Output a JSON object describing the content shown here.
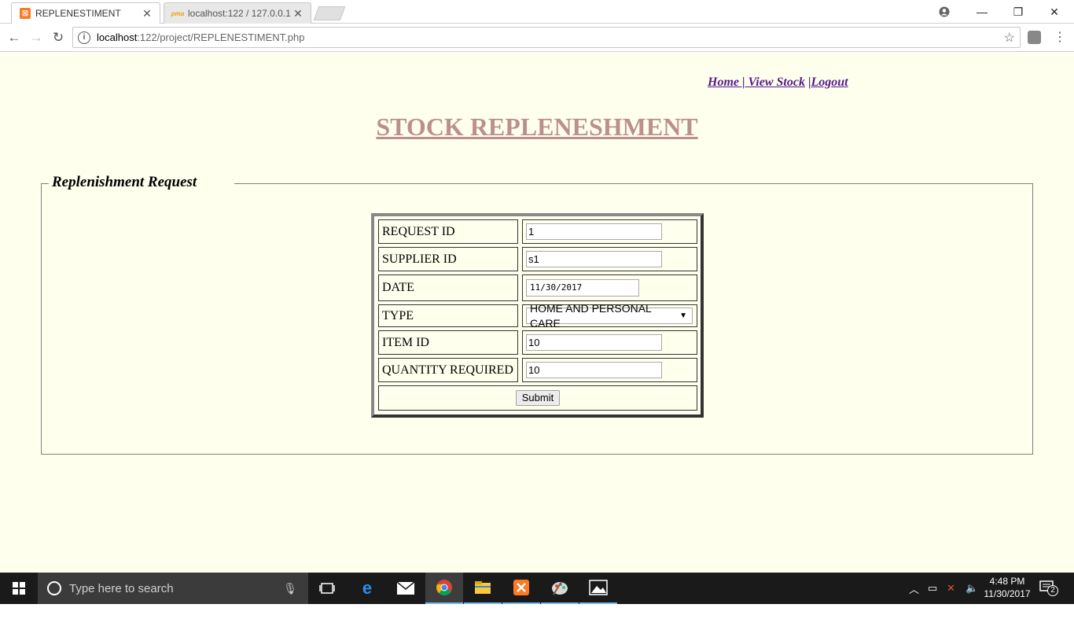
{
  "browser": {
    "tabs": [
      {
        "title": "REPLENESTIMENT",
        "favicon": "xampp-icon",
        "active": true
      },
      {
        "title": "localhost:122 / 127.0.0.1",
        "favicon": "phpmyadmin-icon",
        "active": false
      }
    ],
    "url_host": "localhost",
    "url_path": ":122/project/REPLENESTIMENT.php"
  },
  "nav": {
    "home": "Home |",
    "view_stock": " View Stock",
    "separator": " |",
    "logout": "Logout"
  },
  "page_title": "STOCK REPLENESHMENT",
  "fieldset_legend": "Replenishment Request",
  "form": {
    "rows": [
      {
        "label": "REQUEST ID",
        "value": "1"
      },
      {
        "label": "SUPPLIER ID",
        "value": "s1"
      },
      {
        "label": "DATE",
        "value": "11/30/2017"
      },
      {
        "label": "TYPE",
        "value": "HOME AND PERSONAL CARE"
      },
      {
        "label": "ITEM ID",
        "value": "10"
      },
      {
        "label": "QUANTITY REQUIRED",
        "value": "10"
      }
    ],
    "submit_label": "Submit"
  },
  "taskbar": {
    "search_placeholder": "Type here to search",
    "time": "4:48 PM",
    "date": "11/30/2017",
    "notification_count": "2"
  },
  "colors": {
    "page_bg": "#ffffee",
    "title": "#bc8f8f",
    "link": "#551a8b",
    "taskbar": "#1a1a1a"
  }
}
